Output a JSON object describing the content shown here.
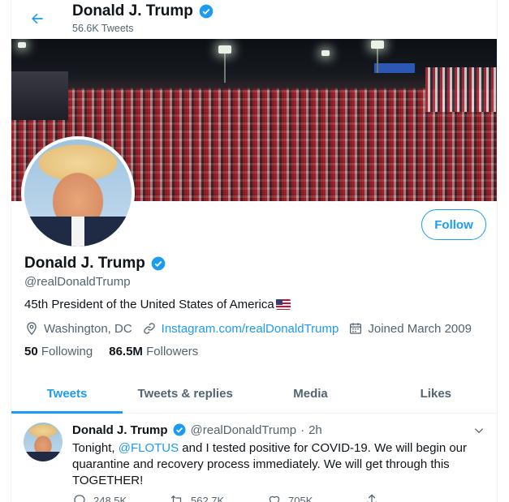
{
  "header": {
    "back_icon": "arrow-left-icon",
    "name": "Donald J. Trump",
    "tweet_count": "56.6K Tweets"
  },
  "profile": {
    "name": "Donald J. Trump",
    "handle": "@realDonaldTrump",
    "bio": "45th President of the United States of America",
    "location": "Washington, DC",
    "link": "Instagram.com/realDonaldTrump",
    "joined": "Joined March 2009",
    "following_count": "50",
    "following_label": "Following",
    "followers_count": "86.5M",
    "followers_label": "Followers",
    "follow_label": "Follow"
  },
  "tabs": [
    {
      "label": "Tweets",
      "active": true
    },
    {
      "label": "Tweets & replies",
      "active": false
    },
    {
      "label": "Media",
      "active": false
    },
    {
      "label": "Likes",
      "active": false
    }
  ],
  "tweet": {
    "name": "Donald J. Trump",
    "handle": "@realDonaldTrump",
    "separator": "·",
    "time": "2h",
    "text_before": "Tonight, ",
    "mention": "@FLOTUS",
    "text_after": " and I tested positive for COVID-19. We will begin our quarantine and recovery process immediately. We will get through this TOGETHER!",
    "reply_count": "248.5K",
    "retweet_count": "562.7K",
    "like_count": "705K"
  },
  "colors": {
    "accent": "#1d9bf0",
    "secondary_text": "#536471",
    "text": "#0f1419"
  }
}
